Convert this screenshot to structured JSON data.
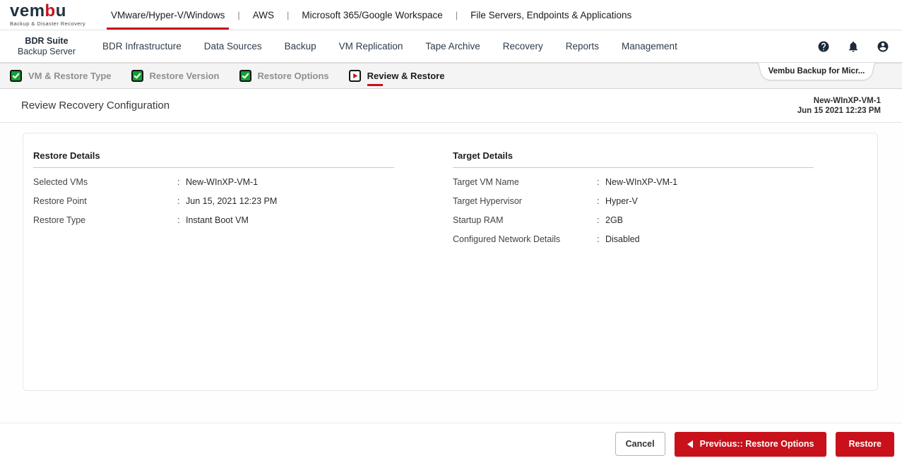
{
  "brand": {
    "name_prefix": "vem",
    "name_accent": "b",
    "name_suffix": "u",
    "tagline": "Backup & Disaster Recovery",
    "accent_red": "#c8111a"
  },
  "top_nav": {
    "items": [
      {
        "label": "VMware/Hyper-V/Windows",
        "active": true
      },
      {
        "label": "AWS",
        "active": false
      },
      {
        "label": "Microsoft 365/Google Workspace",
        "active": false
      },
      {
        "label": "File Servers, Endpoints & Applications",
        "active": false
      }
    ]
  },
  "main_nav": {
    "product_line1": "BDR Suite",
    "product_line2": "Backup Server",
    "items": [
      {
        "label": "BDR Infrastructure"
      },
      {
        "label": "Data Sources"
      },
      {
        "label": "Backup"
      },
      {
        "label": "VM Replication"
      },
      {
        "label": "Tape Archive"
      },
      {
        "label": "Recovery"
      },
      {
        "label": "Reports"
      },
      {
        "label": "Management"
      }
    ],
    "icons": [
      {
        "name": "help-icon"
      },
      {
        "name": "bell-icon"
      },
      {
        "name": "user-icon"
      }
    ]
  },
  "wizard": {
    "steps": [
      {
        "label": "VM & Restore Type",
        "state": "completed"
      },
      {
        "label": "Restore Version",
        "state": "completed"
      },
      {
        "label": "Restore Options",
        "state": "completed"
      },
      {
        "label": "Review & Restore",
        "state": "active"
      }
    ],
    "context_tab": "Vembu Backup for Micr...",
    "completed_color": "#0da32f"
  },
  "page": {
    "title": "Review Recovery Configuration",
    "vm_name": "New-WInXP-VM-1",
    "timestamp": "Jun 15 2021 12:23 PM"
  },
  "restore_details": {
    "title": "Restore Details",
    "rows": [
      {
        "label": "Selected VMs",
        "value": "New-WInXP-VM-1"
      },
      {
        "label": "Restore Point",
        "value": "Jun 15, 2021 12:23 PM"
      },
      {
        "label": "Restore Type",
        "value": "Instant Boot VM"
      }
    ]
  },
  "target_details": {
    "title": "Target Details",
    "rows": [
      {
        "label": "Target VM Name",
        "value": "New-WInXP-VM-1"
      },
      {
        "label": "Target Hypervisor",
        "value": "Hyper-V"
      },
      {
        "label": "Startup RAM",
        "value": "2GB"
      },
      {
        "label": "Configured Network Details",
        "value": "Disabled"
      }
    ]
  },
  "footer": {
    "cancel_label": "Cancel",
    "previous_label": "Previous:: Restore Options",
    "restore_label": "Restore"
  }
}
